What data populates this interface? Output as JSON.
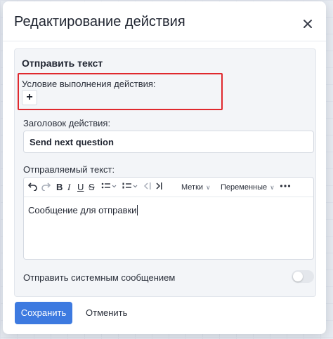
{
  "dialog": {
    "title": "Редактирование действия"
  },
  "action": {
    "section_title": "Отправить текст",
    "condition_label": "Условие выполнения действия:",
    "add_condition_symbol": "+",
    "title_label": "Заголовок действия:",
    "title_value": "Send next question",
    "text_label": "Отправляемый текст:",
    "toolbar": {
      "undo_icon": "undo-icon",
      "redo_icon": "redo-icon",
      "bold": "B",
      "italic": "I",
      "underline": "U",
      "strike": "S",
      "tags_label": "Метки",
      "variables_label": "Переменные",
      "more_icon": "more-icon"
    },
    "text_value": "Сообщение для отправки",
    "system_message_label": "Отправить системным сообщением",
    "system_message_enabled": false
  },
  "footer": {
    "save_label": "Сохранить",
    "cancel_label": "Отменить"
  },
  "colors": {
    "primary": "#3d7ae0",
    "highlight": "#e0292e"
  }
}
